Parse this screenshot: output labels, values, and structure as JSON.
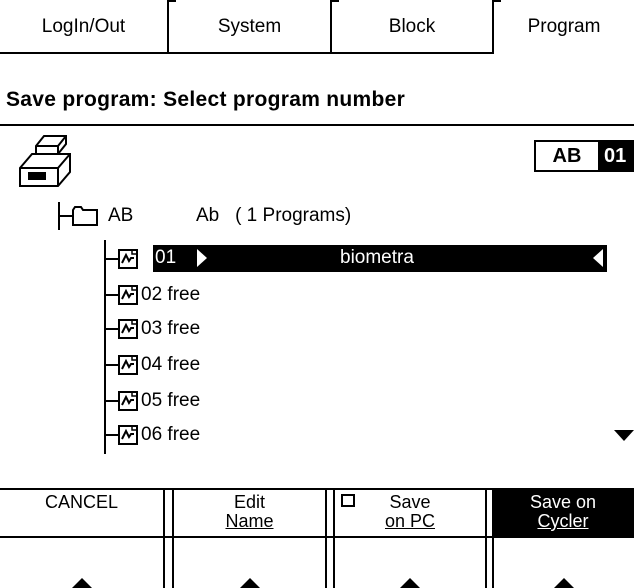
{
  "tabs": [
    {
      "label": "LogIn/Out",
      "active": false
    },
    {
      "label": "System",
      "active": false
    },
    {
      "label": "Block",
      "active": false
    },
    {
      "label": "Program",
      "active": true
    }
  ],
  "page_title": "Save program: Select program number",
  "header_box": {
    "block": "AB",
    "number": "01"
  },
  "folder": {
    "name": "AB",
    "description": "Ab   ( 1 Programs)"
  },
  "selected_program": {
    "number": "01",
    "name": "biometra"
  },
  "programs": [
    {
      "text": "02 free"
    },
    {
      "text": "03 free"
    },
    {
      "text": "04 free"
    },
    {
      "text": "05 free"
    },
    {
      "text": "06 free"
    }
  ],
  "softkeys": {
    "cancel": "CANCEL",
    "edit_line1": "Edit",
    "edit_line2": "Name",
    "save_pc_line1": "Save",
    "save_pc_line2": "on PC",
    "save_cycler_line1": "Save on",
    "save_cycler_line2": "Cycler"
  },
  "icons": {
    "device": "thermocycler-icon",
    "folder": "folder-icon",
    "program": "program-file-icon",
    "pc": "pc-icon"
  }
}
